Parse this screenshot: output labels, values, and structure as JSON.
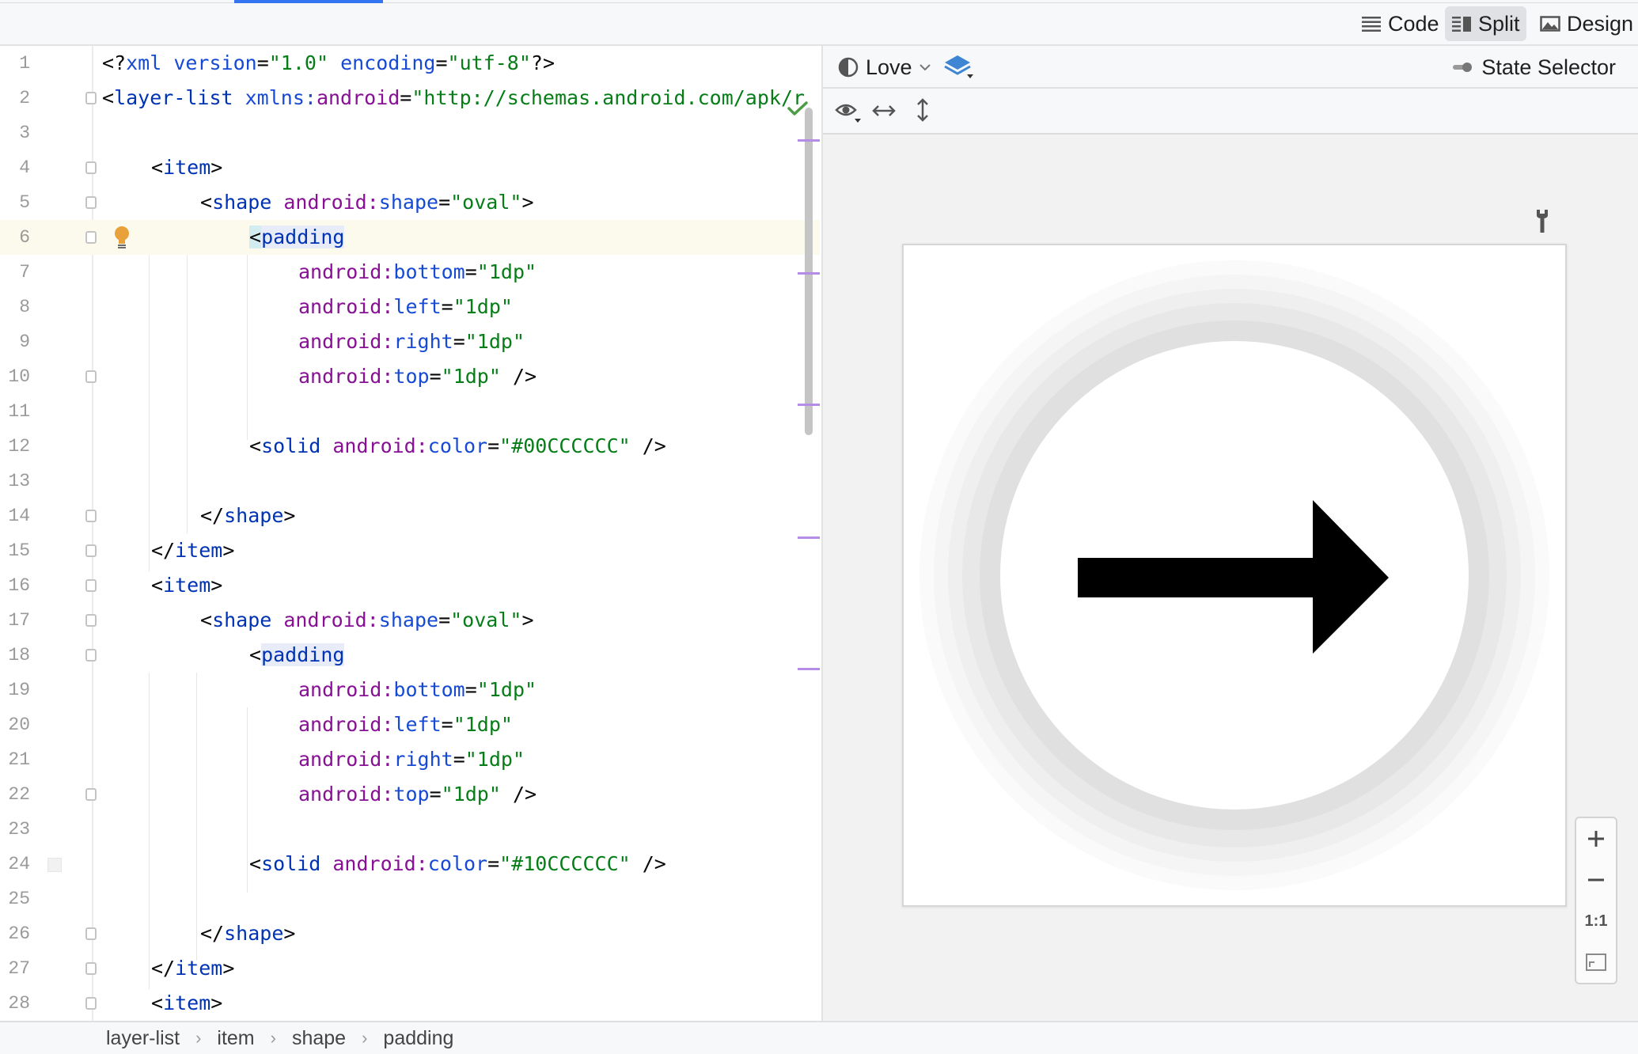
{
  "toolbar": {
    "modes": {
      "code": "Code",
      "split": "Split",
      "design": "Design"
    },
    "active_mode": "Split"
  },
  "editor": {
    "current_line": 6,
    "lines": [
      {
        "n": "1"
      },
      {
        "n": "2"
      },
      {
        "n": "3"
      },
      {
        "n": "4"
      },
      {
        "n": "5"
      },
      {
        "n": "6"
      },
      {
        "n": "7"
      },
      {
        "n": "8"
      },
      {
        "n": "9"
      },
      {
        "n": "10"
      },
      {
        "n": "11"
      },
      {
        "n": "12"
      },
      {
        "n": "13"
      },
      {
        "n": "14"
      },
      {
        "n": "15"
      },
      {
        "n": "16"
      },
      {
        "n": "17"
      },
      {
        "n": "18"
      },
      {
        "n": "19"
      },
      {
        "n": "20"
      },
      {
        "n": "21"
      },
      {
        "n": "22"
      },
      {
        "n": "23"
      },
      {
        "n": "24"
      },
      {
        "n": "25"
      },
      {
        "n": "26"
      },
      {
        "n": "27"
      },
      {
        "n": "28"
      }
    ],
    "tokens": {
      "l1a": "<?",
      "l1b": "xml",
      "l1c": " version",
      "l1d": "=",
      "l1e": "\"1.0\"",
      "l1f": " encoding",
      "l1g": "=",
      "l1h": "\"utf-8\"",
      "l1i": "?>",
      "l2a": "<",
      "l2b": "layer-list",
      "l2c": " xmlns:",
      "l2d": "android",
      "l2e": "=",
      "l2f": "\"http://schemas.android.com/apk/r",
      "item_open_lt": "<",
      "item": "item",
      "gt": ">",
      "shape": "shape",
      "android_ns": " android:",
      "shape_attr": "shape",
      "eq": "=",
      "oval": "\"oval\"",
      "padding": "padding",
      "bottom": "bottom",
      "left": "left",
      "right": "right",
      "top": "top",
      "one_dp": "\"1dp\"",
      "self_close": " />",
      "solid": "solid",
      "color": "color",
      "color1": "\"#00CCCCCC\"",
      "color2": "\"#10CCCCCC\"",
      "close_shape": "</",
      "close_item": "</"
    },
    "android_prefix": "android:"
  },
  "preview": {
    "theme": "Love",
    "state_selector": "State Selector",
    "zoom_fit": "1:1"
  },
  "breadcrumb": [
    "layer-list",
    "item",
    "shape",
    "padding"
  ],
  "colors": {
    "accent": "#3574f0",
    "tag": "#0033b3",
    "attr": "#871094",
    "value": "#067d17",
    "current_line": "#fcfaed",
    "check": "#4d9d45",
    "bulb": "#e9a13b"
  },
  "icons": [
    "code-lines-icon",
    "split-icon",
    "image-icon",
    "check-icon",
    "bulb-icon",
    "theme-icon",
    "layers-icon",
    "toggle-icon",
    "eye-icon",
    "horizontal-resize-icon",
    "vertical-resize-icon",
    "wrench-icon",
    "right-arrow-icon",
    "plus-icon",
    "minus-icon",
    "fit-screen-icon"
  ]
}
